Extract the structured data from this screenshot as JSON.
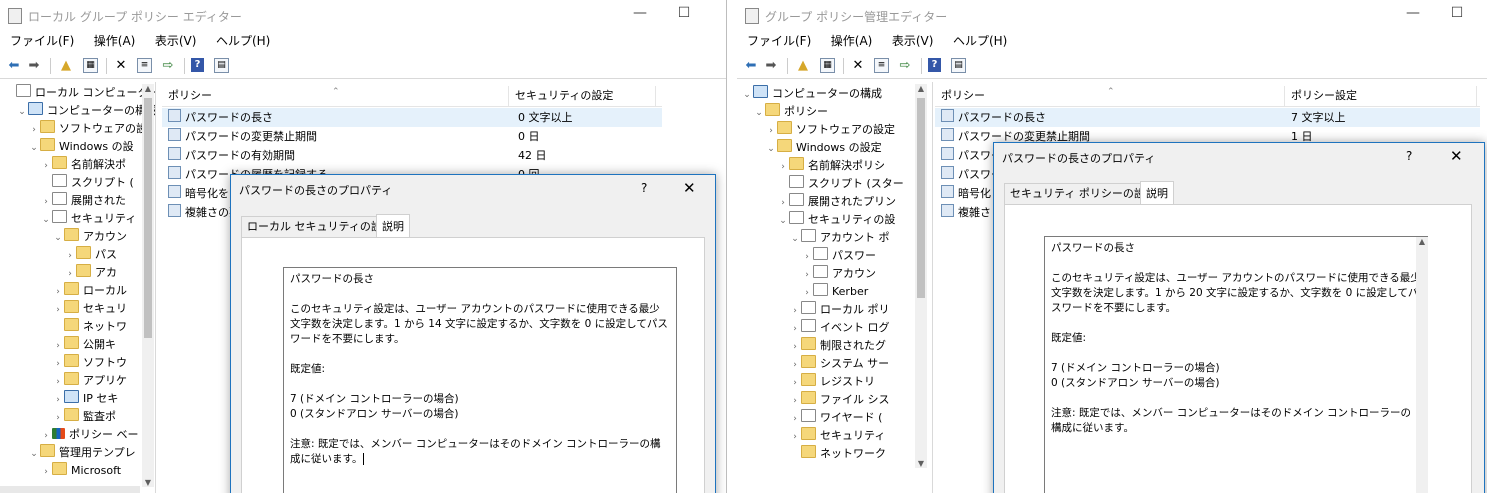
{
  "left_window": {
    "title": "ローカル グループ ポリシー エディター",
    "menu": [
      "ファイル(F)",
      "操作(A)",
      "表示(V)",
      "ヘルプ(H)"
    ],
    "tree": [
      {
        "label": "ローカル コンピューター ポ",
        "indent": 0,
        "chev": "",
        "icon": "doc"
      },
      {
        "label": "コンピューターの構成",
        "indent": 1,
        "chev": "⌄",
        "icon": "pc"
      },
      {
        "label": "ソフトウェアの設",
        "indent": 2,
        "chev": "›",
        "icon": "fold"
      },
      {
        "label": "Windows の設",
        "indent": 2,
        "chev": "⌄",
        "icon": "fold"
      },
      {
        "label": "名前解決ポ",
        "indent": 3,
        "chev": "›",
        "icon": "fold"
      },
      {
        "label": "スクリプト (",
        "indent": 3,
        "chev": "",
        "icon": "doc"
      },
      {
        "label": "展開された",
        "indent": 3,
        "chev": "›",
        "icon": "doc"
      },
      {
        "label": "セキュリティ",
        "indent": 3,
        "chev": "⌄",
        "icon": "doc"
      },
      {
        "label": "アカウン",
        "indent": 4,
        "chev": "⌄",
        "icon": "fold"
      },
      {
        "label": "パス",
        "indent": 5,
        "chev": "›",
        "icon": "fold"
      },
      {
        "label": "アカ",
        "indent": 5,
        "chev": "›",
        "icon": "fold"
      },
      {
        "label": "ローカル",
        "indent": 4,
        "chev": "›",
        "icon": "fold"
      },
      {
        "label": "セキュリ",
        "indent": 4,
        "chev": "›",
        "icon": "fold"
      },
      {
        "label": "ネットワ",
        "indent": 4,
        "chev": "",
        "icon": "fold"
      },
      {
        "label": "公開キ",
        "indent": 4,
        "chev": "›",
        "icon": "fold"
      },
      {
        "label": "ソフトウ",
        "indent": 4,
        "chev": "›",
        "icon": "fold"
      },
      {
        "label": "アプリケ",
        "indent": 4,
        "chev": "›",
        "icon": "fold"
      },
      {
        "label": "IP セキ",
        "indent": 4,
        "chev": "›",
        "icon": "pc"
      },
      {
        "label": "監査ポ",
        "indent": 4,
        "chev": "›",
        "icon": "fold"
      },
      {
        "label": "ポリシー ベー",
        "indent": 3,
        "chev": "›",
        "icon": "chart"
      },
      {
        "label": "管理用テンプレ",
        "indent": 2,
        "chev": "⌄",
        "icon": "fold"
      },
      {
        "label": "Microsoft",
        "indent": 3,
        "chev": "›",
        "icon": "fold"
      }
    ],
    "list_header": {
      "col1": "ポリシー",
      "col2": "セキュリティの設定"
    },
    "list_rows": [
      {
        "name": "パスワードの長さ",
        "value": "0 文字以上"
      },
      {
        "name": "パスワードの変更禁止期間",
        "value": "0 日"
      },
      {
        "name": "パスワードの有効期間",
        "value": "42 日"
      },
      {
        "name": "パスワードの履歴を記録する",
        "value": "0 回"
      },
      {
        "name": "暗号化を",
        "value": ""
      },
      {
        "name": "複雑さの要",
        "value": ""
      }
    ],
    "dialog": {
      "title": "パスワードの長さのプロパティ",
      "help": "?",
      "close": "✕",
      "tabs": [
        "ローカル セキュリティの設定",
        "説明"
      ],
      "explain_title": "パスワードの長さ",
      "explain_body": "このセキュリティ設定は、ユーザー アカウントのパスワードに使用できる最少文字数を決定します。1 から 14 文字に設定するか、文字数を 0 に設定してパスワードを不要にします。",
      "default_label": "既定値:",
      "default_1": "7 (ドメイン コントローラーの場合)",
      "default_2": "0 (スタンドアロン サーバーの場合)",
      "note": "注意: 既定では、メンバー コンピューターはそのドメイン コントローラーの構成に従います。"
    }
  },
  "right_window": {
    "title": "グループ ポリシー管理エディター",
    "menu": [
      "ファイル(F)",
      "操作(A)",
      "表示(V)",
      "ヘルプ(H)"
    ],
    "tree": [
      {
        "label": "コンピューターの構成",
        "indent": 0,
        "chev": "⌄",
        "icon": "pc"
      },
      {
        "label": "ポリシー",
        "indent": 1,
        "chev": "⌄",
        "icon": "fold"
      },
      {
        "label": "ソフトウェアの設定",
        "indent": 2,
        "chev": "›",
        "icon": "fold"
      },
      {
        "label": "Windows の設定",
        "indent": 2,
        "chev": "⌄",
        "icon": "fold"
      },
      {
        "label": "名前解決ポリシ",
        "indent": 3,
        "chev": "›",
        "icon": "fold"
      },
      {
        "label": "スクリプト (スター",
        "indent": 3,
        "chev": "",
        "icon": "doc"
      },
      {
        "label": "展開されたプリン",
        "indent": 3,
        "chev": "›",
        "icon": "doc"
      },
      {
        "label": "セキュリティの設",
        "indent": 3,
        "chev": "⌄",
        "icon": "doc"
      },
      {
        "label": "アカウント ポ",
        "indent": 4,
        "chev": "⌄",
        "icon": "doc"
      },
      {
        "label": "パスワー",
        "indent": 5,
        "chev": "›",
        "icon": "doc"
      },
      {
        "label": "アカウン",
        "indent": 5,
        "chev": "›",
        "icon": "doc"
      },
      {
        "label": "Kerber",
        "indent": 5,
        "chev": "›",
        "icon": "doc"
      },
      {
        "label": "ローカル ポリ",
        "indent": 4,
        "chev": "›",
        "icon": "doc"
      },
      {
        "label": "イベント ログ",
        "indent": 4,
        "chev": "›",
        "icon": "doc"
      },
      {
        "label": "制限されたグ",
        "indent": 4,
        "chev": "›",
        "icon": "fold"
      },
      {
        "label": "システム サー",
        "indent": 4,
        "chev": "›",
        "icon": "fold"
      },
      {
        "label": "レジストリ",
        "indent": 4,
        "chev": "›",
        "icon": "fold"
      },
      {
        "label": "ファイル シス",
        "indent": 4,
        "chev": "›",
        "icon": "fold"
      },
      {
        "label": "ワイヤード (",
        "indent": 4,
        "chev": "›",
        "icon": "doc"
      },
      {
        "label": "セキュリティ",
        "indent": 4,
        "chev": "›",
        "icon": "fold"
      },
      {
        "label": "ネットワーク",
        "indent": 4,
        "chev": "",
        "icon": "fold"
      }
    ],
    "list_header": {
      "col1": "ポリシー",
      "col2": "ポリシー設定"
    },
    "list_rows": [
      {
        "name": "パスワードの長さ",
        "value": "7 文字以上"
      },
      {
        "name": "パスワードの変更禁止期間",
        "value": "1 日"
      },
      {
        "name": "パスワー",
        "value": ""
      },
      {
        "name": "パスワー",
        "value": ""
      },
      {
        "name": "暗号化",
        "value": ""
      },
      {
        "name": "複雑さ",
        "value": ""
      }
    ],
    "dialog": {
      "title": "パスワードの長さのプロパティ",
      "help": "?",
      "close": "✕",
      "tabs": [
        "セキュリティ ポリシーの設定",
        "説明"
      ],
      "explain_title": "パスワードの長さ",
      "explain_body": "このセキュリティ設定は、ユーザー アカウントのパスワードに使用できる最少文字数を決定します。1 から 20 文字に設定するか、文字数を 0 に設定してパスワードを不要にします。",
      "default_label": "既定値:",
      "default_1": "7 (ドメイン コントローラーの場合)",
      "default_2": "0 (スタンドアロン サーバーの場合)",
      "note": "注意: 既定では、メンバー コンピューターはそのドメイン コントローラーの構成に従います。"
    }
  },
  "window_controls": {
    "minimize": "—",
    "maximize": "☐"
  }
}
